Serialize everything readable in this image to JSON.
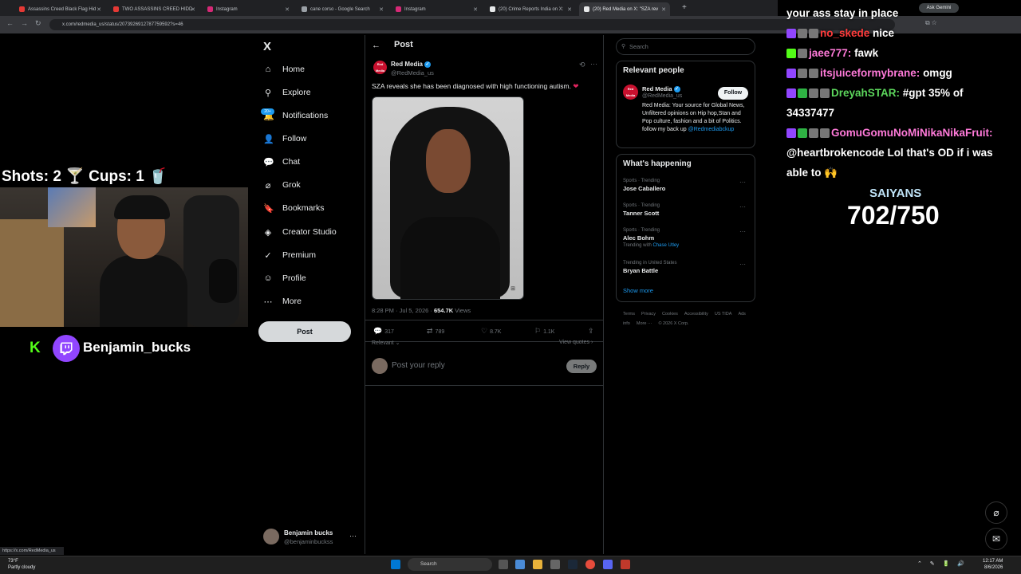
{
  "browser": {
    "tabs": [
      {
        "label": "Assassins Creed Black Flag Hid",
        "color": "#e53935"
      },
      {
        "label": "TWO ASSASSINS CREED HIDD",
        "color": "#e53935"
      },
      {
        "label": "Instagram",
        "color": "#d62976"
      },
      {
        "label": "cane corso - Google Search",
        "color": "#9aa0a6"
      },
      {
        "label": "Instagram",
        "color": "#d62976"
      },
      {
        "label": "(20) Crime Reports India on X:",
        "color": "#e7e9ea"
      },
      {
        "label": "(20) Red Media on X: \"SZA rev",
        "color": "#e7e9ea"
      }
    ],
    "new_tab": "+",
    "url": "x.com/redmedia_us/status/2073926912787759592?s=46",
    "ask_gemini": "Ask Gemini",
    "status_url": "https://x.com/RedMedia_us"
  },
  "overlay": {
    "shots_cups": "Shots: 2 🍸 Cups: 1 🥤",
    "streamer": "Benjamin_bucks",
    "kick_icon": "K",
    "goal_label": "SAIYANS",
    "goal_value": "702/750"
  },
  "x_nav": {
    "logo": "X",
    "items": [
      {
        "label": "Home",
        "icon": "⌂"
      },
      {
        "label": "Explore",
        "icon": "⚲"
      },
      {
        "label": "Notifications",
        "icon": "🔔"
      },
      {
        "label": "Follow",
        "icon": "👤"
      },
      {
        "label": "Chat",
        "icon": "💬"
      },
      {
        "label": "Grok",
        "icon": "⌀"
      },
      {
        "label": "Bookmarks",
        "icon": "🔖"
      },
      {
        "label": "Creator Studio",
        "icon": "◈"
      },
      {
        "label": "Premium",
        "icon": "✓"
      },
      {
        "label": "Profile",
        "icon": "☺"
      },
      {
        "label": "More",
        "icon": "⋯"
      }
    ],
    "notif_badge": "20+",
    "post_button": "Post",
    "account_name": "Benjamin bucks",
    "account_handle": "@benjaminbuckss",
    "account_more": "···"
  },
  "post": {
    "header": "Post",
    "back_icon": "←",
    "author_name": "Red Media",
    "author_handle": "@RedMedia_us",
    "avatar_text": "Red Media",
    "text": "SZA reveals she has been diagnosed with high functioning autism.",
    "heart_emoji": "❤",
    "time": "8:28 PM · Jul 5, 2026 ·",
    "views_count": "654.7K",
    "views_label": "Views",
    "replies": "317",
    "reposts": "789",
    "likes": "8.7K",
    "bookmarks": "1.1K",
    "relevant": "Relevant ⌄",
    "view_quotes": "View quotes ›",
    "reply_placeholder": "Post your reply",
    "reply_button": "Reply"
  },
  "sidebar": {
    "search_placeholder": "Search",
    "relevant_title": "Relevant people",
    "rp_name": "Red Media",
    "rp_handle": "@RedMedia_us",
    "follow_label": "Follow",
    "rp_bio": "Red Media: Your source for Global News, Unfiltered opinions on Hip hop,Stan and Pop culture, fashion and a bit of Politics. follow my back up",
    "rp_link": "@Redmediabckup",
    "happening_title": "What's happening",
    "trends": [
      {
        "context": "Sports · Trending",
        "title": "Jose Caballero",
        "with": ""
      },
      {
        "context": "Sports · Trending",
        "title": "Tanner Scott",
        "with": ""
      },
      {
        "context": "Sports · Trending",
        "title": "Alec Bohm",
        "with_prefix": "Trending with",
        "with": "Chase Utley"
      },
      {
        "context": "Trending in United States",
        "title": "Bryan Battle",
        "with": ""
      }
    ],
    "show_more": "Show more",
    "footer": [
      "Terms",
      "Privacy",
      "Cookies",
      "Accessibility",
      "US TIDA",
      "Ads info",
      "More ···",
      "© 2026 X Corp."
    ]
  },
  "chat": [
    {
      "badges": [],
      "user": "",
      "user_color": "#ffffff",
      "msg": "your ass stay in place"
    },
    {
      "badges": [
        "tw",
        "gy",
        "gy"
      ],
      "user": "no_skede",
      "user_color": "#ff3b3b",
      "msg": "nice"
    },
    {
      "badges": [
        "kk",
        "gy"
      ],
      "user": "jaee777:",
      "user_color": "#ff7ad9",
      "msg": "fawk"
    },
    {
      "badges": [
        "tw",
        "gy",
        "gy"
      ],
      "user": "itsjuiceformybrane:",
      "user_color": "#ff7ad9",
      "msg": "omgg"
    },
    {
      "badges": [
        "tw",
        "ch",
        "gy",
        "gy"
      ],
      "user": "DreyahSTAR:",
      "user_color": "#5cd65c",
      "msg": "#gpt 35% of"
    },
    {
      "badges": [],
      "user": "",
      "user_color": "#ffffff",
      "msg": "34337477"
    },
    {
      "badges": [
        "tw",
        "ch",
        "gy",
        "gy"
      ],
      "user": "GomuGomuNoMiNikaNikaFruit:",
      "user_color": "#ff7ad9",
      "msg": ""
    },
    {
      "badges": [],
      "user": "",
      "user_color": "#ffffff",
      "msg": "@heartbrokencode Lol that's OD if i was"
    },
    {
      "badges": [],
      "user": "",
      "user_color": "#ffffff",
      "msg": "able to 🙌"
    }
  ],
  "taskbar": {
    "temp": "73°F",
    "weather": "Partly cloudy",
    "search": "Search",
    "time": "12:17 AM",
    "date": "8/6/2026"
  }
}
